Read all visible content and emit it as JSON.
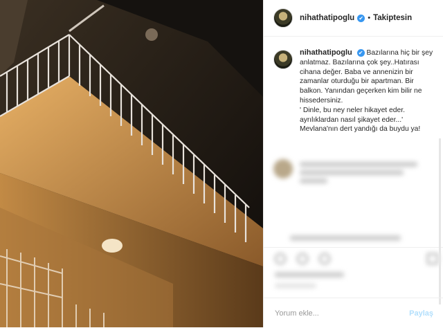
{
  "post": {
    "username": "nihathatipoglu",
    "verified_mark": "✔",
    "separator": "•",
    "follow_status": "Takiptesin",
    "caption": "Bazılarına hiç bir şey anlatmaz. Bazılarına çok şey..Hatırası cihana değer. Baba ve annenizin bir zamanlar oturduğu bir apartman. Bir balkon. Yanından geçerken kim bilir ne hissedersiniz.\n' Dinle, bu ney neler hikayet eder.\nayrılıklardan nasıl şikayet eder...'\nMevlana'nın dert yandığı da buydu ya!"
  },
  "comment_box": {
    "placeholder": "Yorum ekle...",
    "post_label": "Paylaş"
  },
  "icons": {
    "like": "heart-icon",
    "comment": "comment-icon",
    "share": "share-icon",
    "save": "bookmark-icon"
  },
  "colors": {
    "verified": "#3897f0",
    "post_button_disabled": "#b2dffc"
  }
}
